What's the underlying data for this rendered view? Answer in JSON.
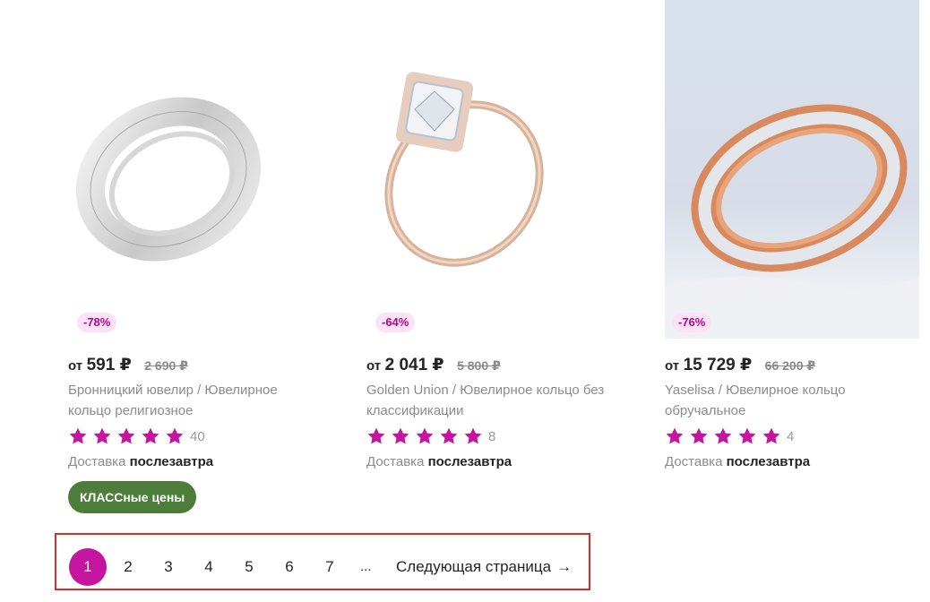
{
  "products": [
    {
      "discount": "-78%",
      "from_label": "от",
      "price": "591 ₽",
      "old_price": "2 690 ₽",
      "title": "Бронницкий ювелир / Ювелирное кольцо религиозное",
      "rating": 5,
      "reviews": "40",
      "delivery_label": "Доставка",
      "delivery_value": "послезавтра",
      "promo": "КЛАССные цены"
    },
    {
      "discount": "-64%",
      "from_label": "от",
      "price": "2 041 ₽",
      "old_price": "5 800 ₽",
      "title": "Golden Union / Ювелирное кольцо без классификации",
      "rating": 5,
      "reviews": "8",
      "delivery_label": "Доставка",
      "delivery_value": "послезавтра"
    },
    {
      "discount": "-76%",
      "from_label": "от",
      "price": "15 729 ₽",
      "old_price": "66 200 ₽",
      "title": "Yaselisa / Ювелирное кольцо обручальное",
      "rating": 5,
      "reviews": "4",
      "delivery_label": "Доставка",
      "delivery_value": "послезавтра"
    }
  ],
  "pagination": {
    "pages": [
      "1",
      "2",
      "3",
      "4",
      "5",
      "6",
      "7"
    ],
    "current": "1",
    "ellipsis": "...",
    "next_label": "Следующая страница",
    "next_arrow": "→"
  },
  "colors": {
    "accent": "#c514a0",
    "star": "#c514a0",
    "badge_bg": "#fbe3f5",
    "promo_bg": "#4c7d3a",
    "highlight_border": "#d32f2f"
  }
}
